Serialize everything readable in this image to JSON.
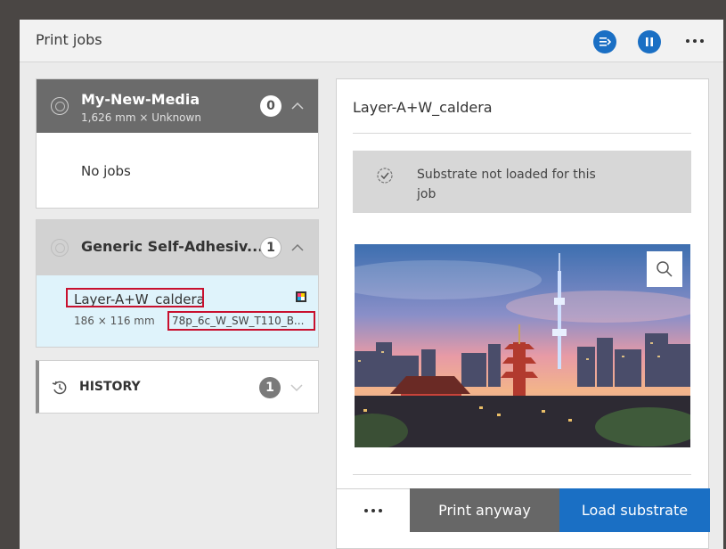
{
  "header": {
    "title": "Print jobs"
  },
  "queues": [
    {
      "name": "My-New-Media",
      "size": "1,626 mm × Unknown",
      "count": "0",
      "empty_label": "No jobs"
    },
    {
      "name": "Generic Self-Adhesiv...",
      "count": "1",
      "jobs": [
        {
          "name": "Layer-A+W_caldera",
          "dimensions": "186 × 116 mm",
          "profile": "78p_6c_W_SW_T110_B..."
        }
      ]
    }
  ],
  "history": {
    "label": "HISTORY",
    "count": "1"
  },
  "detail": {
    "job_name": "Layer-A+W_caldera",
    "warning": "Substrate not loaded for this job"
  },
  "actions": {
    "print_anyway": "Print anyway",
    "load_substrate": "Load substrate"
  },
  "colors": {
    "accent": "#1a6fc4",
    "header_dark": "#6b6b6b",
    "selected_job": "#dff3fb",
    "highlight": "#c8102e"
  }
}
